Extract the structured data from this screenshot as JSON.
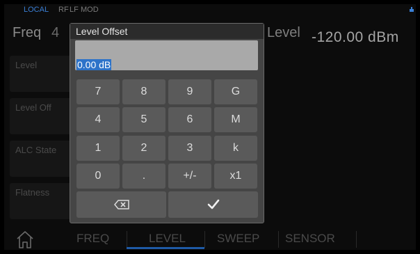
{
  "status": {
    "local": "LOCAL",
    "rf": "RF",
    "lf": "LF",
    "mod": "MOD",
    "usb_icon": "usb-icon"
  },
  "header": {
    "freq_label": "Freq",
    "freq_value_partial": "4",
    "level_label": "Level",
    "level_value": "-120.00 dBm"
  },
  "menu": {
    "items": [
      {
        "label": "Level"
      },
      {
        "label": "Level Off"
      },
      {
        "label": "ALC State"
      },
      {
        "label": "Flatness"
      }
    ]
  },
  "dialog": {
    "title": "Level Offset",
    "value": "0.00 dB",
    "keys": [
      [
        "7",
        "8",
        "9",
        "G"
      ],
      [
        "4",
        "5",
        "6",
        "M"
      ],
      [
        "1",
        "2",
        "3",
        "k"
      ],
      [
        "0",
        ".",
        "+/-",
        "x1"
      ]
    ],
    "backspace_icon": "backspace-icon",
    "confirm_icon": "check-icon"
  },
  "nav": {
    "home_icon": "home-icon",
    "tabs": [
      "FREQ",
      "LEVEL",
      "SWEEP",
      "SENSOR"
    ],
    "active_tab": "LEVEL"
  },
  "colors": {
    "accent": "#2d73c9",
    "status_local": "#3a7fd6",
    "background": "#0c0c0c",
    "dialog_bg": "#454545",
    "key_bg": "#5a5a5a"
  }
}
